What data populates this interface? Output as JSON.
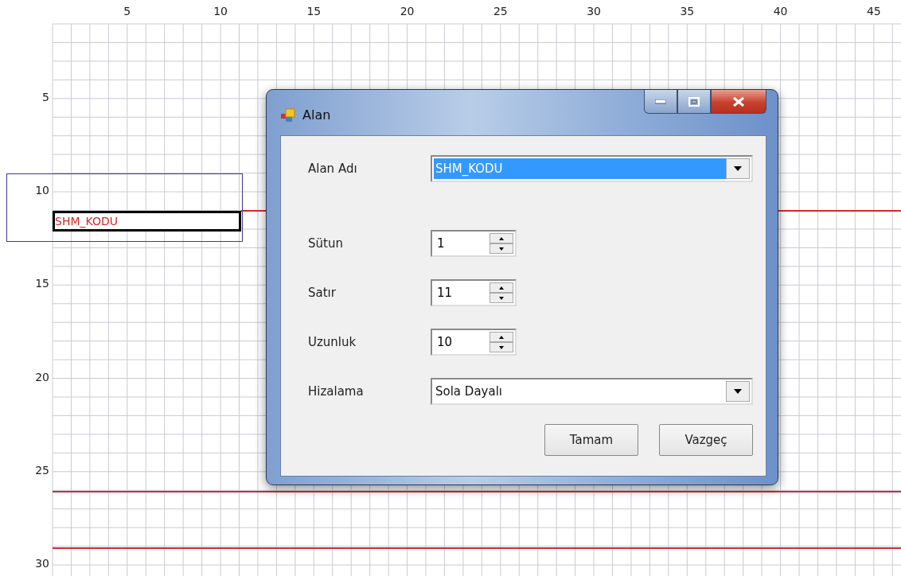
{
  "ruler": {
    "columns": [
      "5",
      "10",
      "15",
      "20",
      "25",
      "30",
      "35",
      "40",
      "45"
    ],
    "rows": [
      "5",
      "10",
      "15",
      "20",
      "25",
      "30"
    ]
  },
  "canvas_field": {
    "text": "SHM_KODU",
    "selected": true
  },
  "dialog": {
    "title": "Alan",
    "fields": [
      {
        "label": "Alan Adı",
        "kind": "combo",
        "value": "SHM_KODU",
        "selected": true
      },
      {
        "label": "Sütun",
        "kind": "spinner",
        "value": "1"
      },
      {
        "label": "Satır",
        "kind": "spinner",
        "value": "11"
      },
      {
        "label": "Uzunluk",
        "kind": "spinner",
        "value": "10"
      },
      {
        "label": "Hizalama",
        "kind": "combo",
        "value": "Sola Dayalı",
        "selected": false
      }
    ],
    "buttons": [
      "Tamam",
      "Vazgeç"
    ]
  }
}
